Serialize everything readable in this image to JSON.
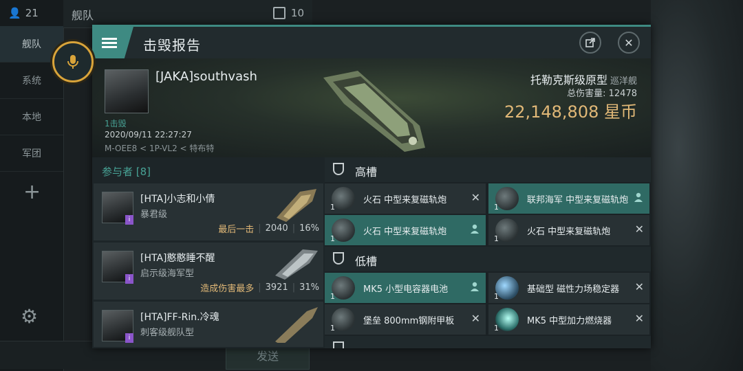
{
  "background": {
    "online_count": "21",
    "nav_items": [
      "舰队",
      "系统",
      "本地",
      "军团"
    ],
    "header_title": "舰队",
    "header_count": "10",
    "send_label": "发送"
  },
  "window": {
    "title": "击毁报告",
    "victim": {
      "pilot": "[JAKA]southvash",
      "kills_label": "1击毁",
      "datetime": "2020/09/11 22:27:27",
      "route": "M-OEE8 < 1P-VL2 < 特布特",
      "ship_name": "托勒克斯级原型",
      "ship_class": "巡洋舰",
      "damage_label": "总伤害量: 12478",
      "isk_value": "22,148,808 星币"
    },
    "participants": {
      "header": "参与者 [8]",
      "rows": [
        {
          "name": "[HTA]小志和小倩",
          "ship": "暴君级",
          "tag": "最后一击",
          "damage": "2040",
          "percent": "16%"
        },
        {
          "name": "[HTA]憨憨睡不醒",
          "ship": "启示级海军型",
          "tag": "造成伤害最多",
          "damage": "3921",
          "percent": "31%"
        },
        {
          "name": "[HTA]FF-Rin.冷魂",
          "ship": "刺客级舰队型",
          "tag": "",
          "damage": "",
          "percent": ""
        }
      ]
    },
    "sections": {
      "high": {
        "title": "高槽",
        "modules": [
          {
            "name": "火石 中型来复磁轨炮",
            "qty": "1"
          },
          {
            "name": "联邦海军 中型来复磁轨炮",
            "qty": "1"
          },
          {
            "name": "火石 中型来复磁轨炮",
            "qty": "1"
          },
          {
            "name": "火石 中型来复磁轨炮",
            "qty": "1"
          }
        ]
      },
      "low": {
        "title": "低槽",
        "modules": [
          {
            "name": "MK5 小型电容器电池",
            "qty": "1"
          },
          {
            "name": "基础型 磁性力场稳定器",
            "qty": "1"
          },
          {
            "name": "堡垒 800mm钢附甲板",
            "qty": "1"
          },
          {
            "name": "MK5 中型加力燃烧器",
            "qty": "1"
          }
        ]
      }
    }
  }
}
